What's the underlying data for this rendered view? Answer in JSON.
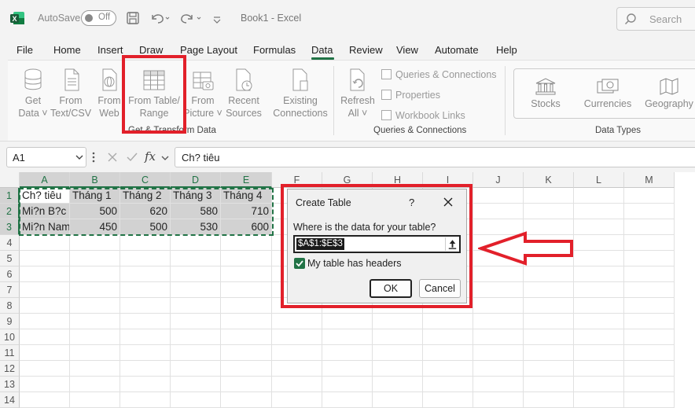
{
  "titlebar": {
    "autosave_label": "AutoSave",
    "autosave_state": "Off",
    "doc_title": "Book1  -  Excel",
    "search_placeholder": "Search"
  },
  "tabs": [
    "File",
    "Home",
    "Insert",
    "Draw",
    "Page Layout",
    "Formulas",
    "Data",
    "Review",
    "View",
    "Automate",
    "Help"
  ],
  "active_tab": "Data",
  "ribbon": {
    "get_data_1": "Get",
    "get_data_2": "Data ˅",
    "from_csv_1": "From",
    "from_csv_2": "Text/CSV",
    "from_web_1": "From",
    "from_web_2": "Web",
    "from_table_1": "From Table/",
    "from_table_2": "Range",
    "from_picture_1": "From",
    "from_picture_2": "Picture ˅",
    "recent_1": "Recent",
    "recent_2": "Sources",
    "existing_1": "Existing",
    "existing_2": "Connections",
    "group_get_transform": "Get & Transform Data",
    "refresh_1": "Refresh",
    "refresh_2": "All ˅",
    "queries_connections": "Queries & Connections",
    "properties": "Properties",
    "workbook_links": "Workbook Links",
    "group_queries": "Queries & Connections",
    "stocks": "Stocks",
    "currencies": "Currencies",
    "geography": "Geography",
    "group_data_types": "Data Types"
  },
  "formula_bar": {
    "name_box": "A1",
    "fx": "fx",
    "content": "Ch? tiêu"
  },
  "grid": {
    "columns": [
      "A",
      "B",
      "C",
      "D",
      "E",
      "F",
      "G",
      "H",
      "I",
      "J",
      "K",
      "L",
      "M"
    ],
    "rows": [
      "1",
      "2",
      "3",
      "4",
      "5",
      "6",
      "7",
      "8",
      "9",
      "10",
      "11",
      "12",
      "13",
      "14"
    ],
    "data": [
      [
        "Ch? tiêu",
        "Tháng 1",
        "Tháng 2",
        "Tháng 3",
        "Tháng 4"
      ],
      [
        "Mi?n B?c",
        "500",
        "620",
        "580",
        "710"
      ],
      [
        "Mi?n Nam",
        "450",
        "500",
        "530",
        "600"
      ]
    ]
  },
  "dialog": {
    "title": "Create Table",
    "help": "?",
    "prompt": "Where is the data for your table?",
    "range": "$A$1:$E$3",
    "has_headers_label": "My table has headers",
    "has_headers_checked": true,
    "ok": "OK",
    "cancel": "Cancel"
  },
  "colors": {
    "excel_green": "#217346",
    "highlight_red": "#e2202a"
  }
}
